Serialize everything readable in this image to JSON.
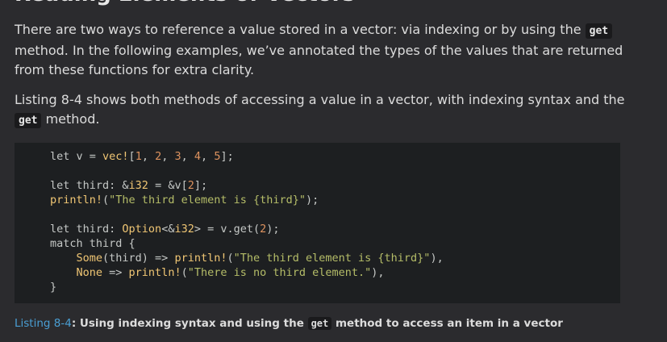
{
  "heading": "Reading Elements of Vectors",
  "para1": {
    "before": "There are two ways to reference a value stored in a vector: via indexing or by using the ",
    "code": "get",
    "after": " method. In the following examples, we’ve annotated the types of the values that are returned from these functions for extra clarity."
  },
  "para2": {
    "before": "Listing 8-4 shows both methods of accessing a value in a vector, with indexing syntax and the ",
    "code": "get",
    "after": " method."
  },
  "code": {
    "l1a": "let v = ",
    "l1mac": "vec!",
    "l1b": "[",
    "n1": "1",
    "c1": ", ",
    "n2": "2",
    "c2": ", ",
    "n3": "3",
    "c3": ", ",
    "n4": "4",
    "c4": ", ",
    "n5": "5",
    "l1c": "];",
    "l2a": "let third: &",
    "l2ty": "i32",
    "l2b": " = &v[",
    "l2n": "2",
    "l2c": "];",
    "l3mac": "println!",
    "l3a": "(",
    "l3str": "\"The third element is {third}\"",
    "l3b": ");",
    "l4a": "let third: ",
    "l4ty": "Option",
    "l4b": "<&",
    "l4ty2": "i32",
    "l4c": "> = v.get(",
    "l4n": "2",
    "l4d": ");",
    "l5": "match third {",
    "l6ty": "Some",
    "l6a": "(third) => ",
    "l6mac": "println!",
    "l6b": "(",
    "l6str": "\"The third element is {third}\"",
    "l6c": "),",
    "l7ty": "None",
    "l7a": " => ",
    "l7mac": "println!",
    "l7b": "(",
    "l7str": "\"There is no third element.\"",
    "l7c": "),",
    "l8": "}"
  },
  "caption": {
    "link": "Listing 8-4",
    "before": ": Using indexing syntax and using the ",
    "code": "get",
    "after": " method to access an item in a vector"
  }
}
